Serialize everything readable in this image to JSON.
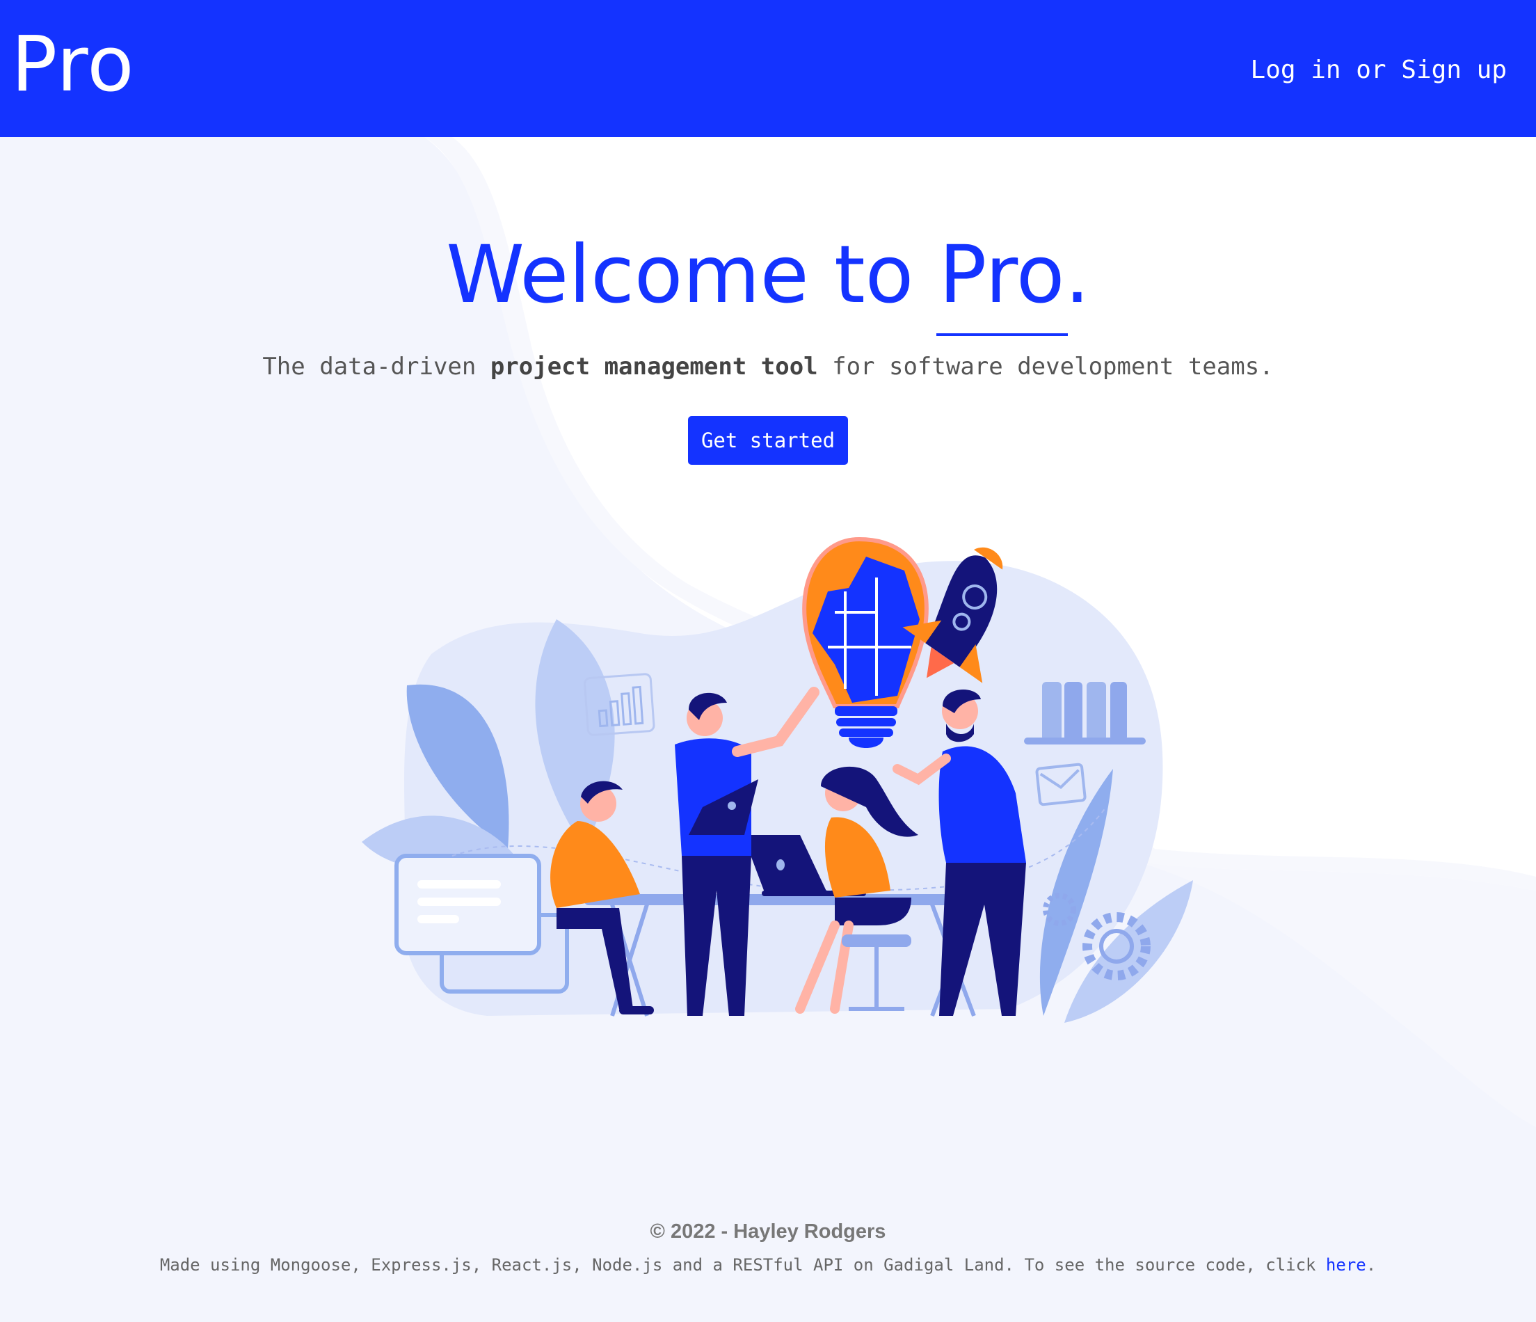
{
  "header": {
    "brand": "Pro",
    "auth_login": "Log in",
    "auth_or": " or ",
    "auth_signup": "Sign up"
  },
  "hero": {
    "title_prefix": "Welcome to ",
    "title_brand": "Pro",
    "title_suffix": ".",
    "tagline_before": "The data-driven ",
    "tagline_bold": "project management tool",
    "tagline_after": " for software development teams.",
    "cta_label": "Get started"
  },
  "illustration": {
    "subject": "team-collaboration",
    "icons": [
      "lightbulb-puzzle-icon",
      "rocket-icon",
      "bar-chart-icon",
      "envelope-icon",
      "gear-icon",
      "binders-icon",
      "chat-bubble-icon",
      "plant-icon"
    ]
  },
  "footer": {
    "copyright": "© 2022 - Hayley Rodgers",
    "credits_text": "Made using Mongoose, Express.js, React.js, Node.js and a RESTful API on Gadigal Land. To see the source code, click ",
    "credits_link": "here",
    "credits_end": "."
  },
  "colors": {
    "brand_blue": "#1433ff",
    "background": "#f3f5fd",
    "accent_orange": "#ff8a1a",
    "navy": "#14147a"
  }
}
